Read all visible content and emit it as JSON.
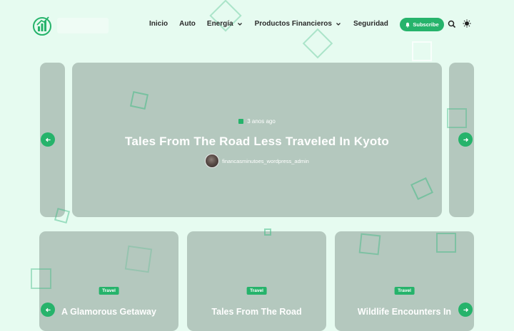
{
  "header": {
    "nav": [
      {
        "label": "Inicio",
        "dropdown": false
      },
      {
        "label": "Auto",
        "dropdown": false
      },
      {
        "label": "Energía",
        "dropdown": true
      },
      {
        "label": "Productos Financieros",
        "dropdown": true
      },
      {
        "label": "Seguridad",
        "dropdown": false
      }
    ],
    "subscribe_label": "Subscribe"
  },
  "hero": {
    "date": "3 anos ago",
    "title": "Tales From The Road Less Traveled In Kyoto",
    "author": "financasminutoes_wordpress_admin"
  },
  "cards": [
    {
      "tag": "Travel",
      "title": "A Glamorous Getaway"
    },
    {
      "tag": "Travel",
      "title": "Tales From The Road"
    },
    {
      "tag": "Travel",
      "title": "Wildlife Encounters In"
    }
  ],
  "colors": {
    "accent": "#26b36b",
    "card": "#b4c8be",
    "background": "#e6fbf0"
  },
  "icons": [
    "logo-icon",
    "chevron-down-icon",
    "bell-icon",
    "search-icon",
    "moon-icon",
    "calendar-icon",
    "arrow-left-icon",
    "arrow-right-icon"
  ]
}
